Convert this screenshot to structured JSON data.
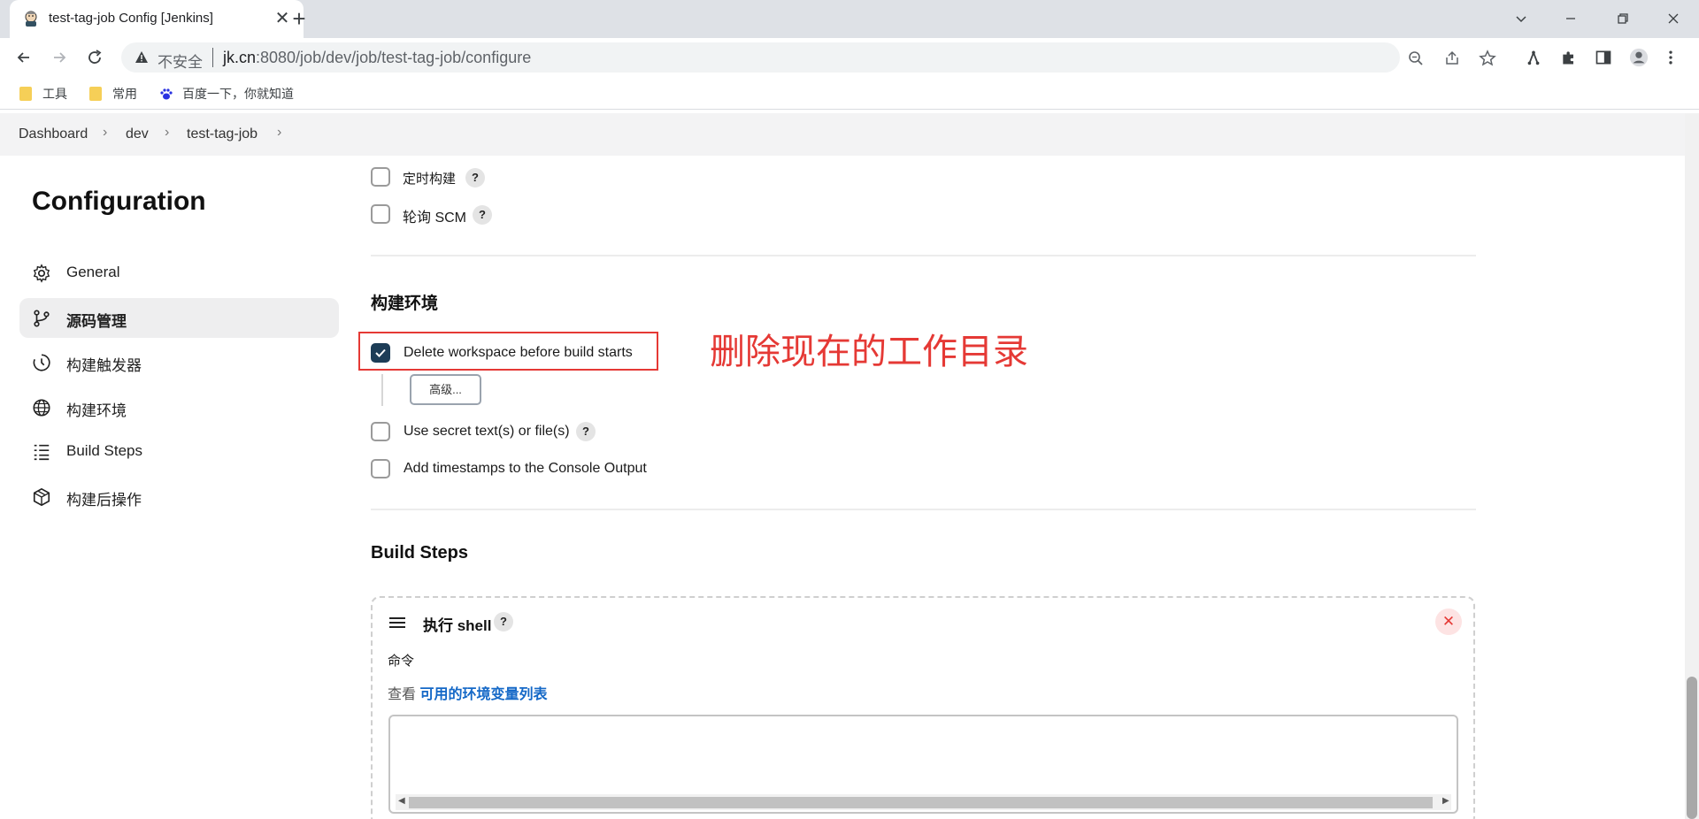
{
  "browser": {
    "tab_title": "test-tag-job Config [Jenkins]",
    "tab_close": "✕",
    "new_tab": "+",
    "insecure_label": "不安全",
    "url_host": "jk.cn",
    "url_rest": ":8080/job/dev/job/test-tag-job/configure",
    "bookmarks": [
      {
        "label": "工具",
        "icon": "folder-icon"
      },
      {
        "label": "常用",
        "icon": "folder-icon"
      },
      {
        "label": "百度一下，你就知道",
        "icon": "baidu-paw-icon"
      }
    ]
  },
  "breadcrumbs": [
    {
      "label": "Dashboard"
    },
    {
      "label": "dev"
    },
    {
      "label": "test-tag-job"
    }
  ],
  "breadcrumb_separator": "›",
  "sidebar": {
    "title": "Configuration",
    "items": [
      {
        "label": "General",
        "icon": "gear-icon",
        "active": false
      },
      {
        "label": "源码管理",
        "icon": "branch-icon",
        "active": true
      },
      {
        "label": "构建触发器",
        "icon": "clock-icon",
        "active": false
      },
      {
        "label": "构建环境",
        "icon": "globe-icon",
        "active": false
      },
      {
        "label": "Build Steps",
        "icon": "list-icon",
        "active": false
      },
      {
        "label": "构建后操作",
        "icon": "box-icon",
        "active": false
      }
    ]
  },
  "triggers": {
    "items": [
      {
        "label": "定时构建",
        "checked": false
      },
      {
        "label": "轮询 SCM",
        "checked": false
      }
    ]
  },
  "help_glyph": "?",
  "build_env": {
    "title": "构建环境",
    "delete_workspace": {
      "label": "Delete workspace before build starts",
      "checked": true
    },
    "advanced_button": "高级...",
    "secret": {
      "label": "Use secret text(s) or file(s)",
      "checked": false
    },
    "timestamps": {
      "label": "Add timestamps to the Console Output",
      "checked": false
    }
  },
  "annotation": {
    "text": "删除现在的工作目录",
    "color": "#e53935"
  },
  "build_steps": {
    "title": "Build Steps",
    "step": {
      "title": "执行 shell",
      "delete_glyph": "✕",
      "command_label": "命令",
      "env_prefix": "查看",
      "env_link": "可用的环境变量列表",
      "command_value": ""
    }
  },
  "colors": {
    "accent_link": "#1468c7",
    "checkbox_checked": "#1d3d57",
    "annotation_red": "#e53935"
  }
}
